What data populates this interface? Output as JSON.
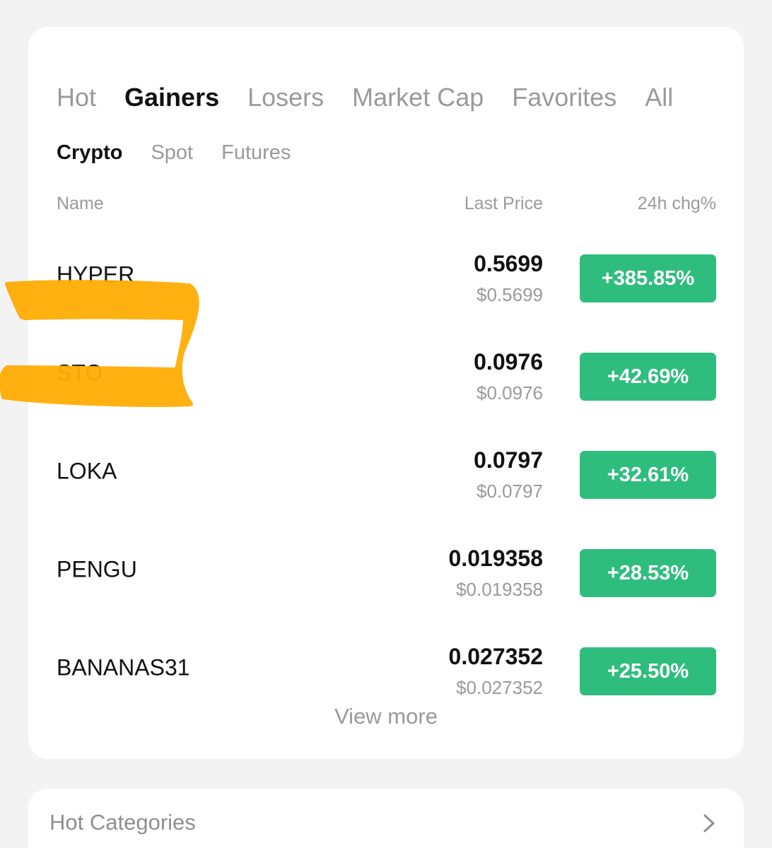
{
  "market": {
    "tabs": [
      {
        "label": "Hot"
      },
      {
        "label": "Gainers"
      },
      {
        "label": "Losers"
      },
      {
        "label": "Market Cap"
      },
      {
        "label": "Favorites"
      },
      {
        "label": "All"
      }
    ],
    "active_tab": "Gainers",
    "subtabs": [
      {
        "label": "Crypto"
      },
      {
        "label": "Spot"
      },
      {
        "label": "Futures"
      }
    ],
    "active_subtab": "Crypto",
    "columns": {
      "name": "Name",
      "last_price": "Last Price",
      "change": "24h chg%"
    },
    "rows": [
      {
        "name": "HYPER",
        "price": "0.5699",
        "usd": "$0.5699",
        "change": "+385.85%"
      },
      {
        "name": "STO",
        "price": "0.0976",
        "usd": "$0.0976",
        "change": "+42.69%"
      },
      {
        "name": "LOKA",
        "price": "0.0797",
        "usd": "$0.0797",
        "change": "+32.61%"
      },
      {
        "name": "PENGU",
        "price": "0.019358",
        "usd": "$0.019358",
        "change": "+28.53%"
      },
      {
        "name": "BANANAS31",
        "price": "0.027352",
        "usd": "$0.027352",
        "change": "+25.50%"
      }
    ],
    "view_more": "View more"
  },
  "hot_categories": {
    "title": "Hot Categories",
    "icon": "chevron-right-icon"
  },
  "colors": {
    "gain_badge": "#2fbd7e",
    "highlight_marker": "#ffad05",
    "muted_text": "#9a9a9a"
  }
}
